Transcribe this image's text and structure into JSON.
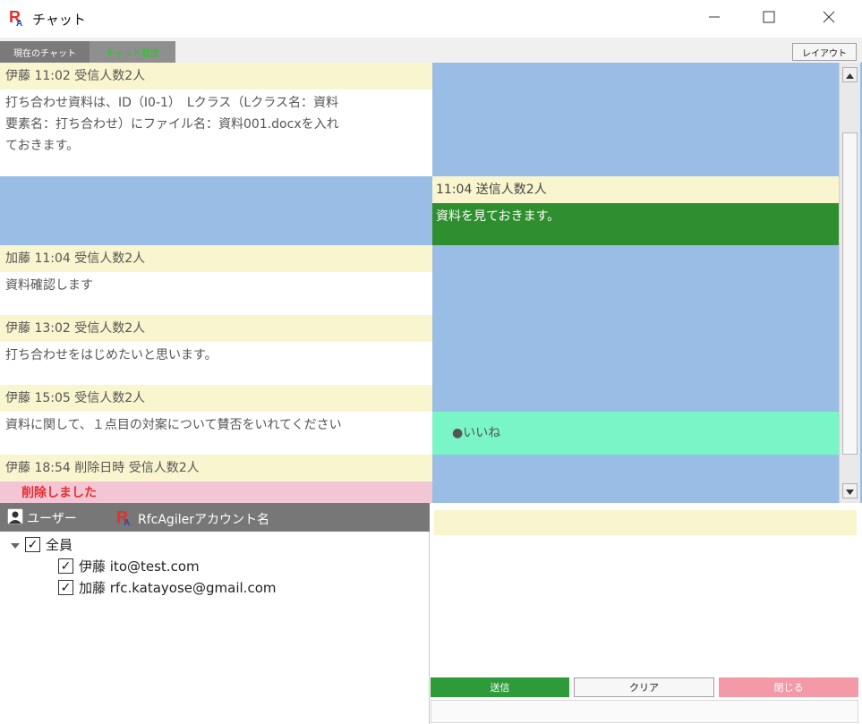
{
  "window": {
    "title": "チャット",
    "logo_letters": "RA",
    "colors": {
      "brand_red": "#e3312b",
      "brand_blue": "#1a4fb3"
    }
  },
  "tabs": [
    {
      "label": "現在のチャット",
      "active": false
    },
    {
      "label": "チャット履歴",
      "active": true
    }
  ],
  "layout_button_label": "レイアウト",
  "messages": [
    {
      "header": "伊藤  11:02  受信人数2人",
      "body_lines": [
        "打ち合わせ資料は、ID（I0-1）　Lクラス（Lクラス名：資料",
        "要素名：打ち合わせ）にファイル名：資料001.docxを入れ",
        "ておきます。"
      ]
    },
    {
      "header": "11:04  送信人数2人",
      "body": "資料を見ておきます。",
      "sent": true
    },
    {
      "header": "加藤  11:04  受信人数2人",
      "body": "資料確認します"
    },
    {
      "header": "伊藤  13:02  受信人数2人",
      "body": "打ち合わせをはじめたいと思います。"
    },
    {
      "header": "伊藤  15:05  受信人数2人",
      "body": "資料に関して、１点目の対案について賛否をいれてください"
    },
    {
      "header": "伊藤  18:54  削除日時  受信人数2人",
      "body": "削除しました",
      "deleted": true
    }
  ],
  "reaction": {
    "label": "●いいね"
  },
  "users_panel": {
    "col_user": "ユーザー",
    "col_account": "RfcAgilerアカウント名",
    "tree": {
      "root": {
        "label": "全員",
        "checked": true,
        "expanded": true
      },
      "children": [
        {
          "label": "伊藤 ito@test.com",
          "checked": true
        },
        {
          "label": "加藤 rfc.katayose@gmail.com",
          "checked": true
        }
      ]
    }
  },
  "compose": {
    "send_label": "送信",
    "clear_label": "クリア",
    "close_label": "閉じる"
  },
  "colors": {
    "chat_bg": "#99bde5",
    "header_bg": "#f9f6cf",
    "sent_bg": "#2f8f2f",
    "reaction_bg": "#7af5c8",
    "deleted_bg": "#f3c6d6",
    "deleted_text": "#e53030"
  }
}
